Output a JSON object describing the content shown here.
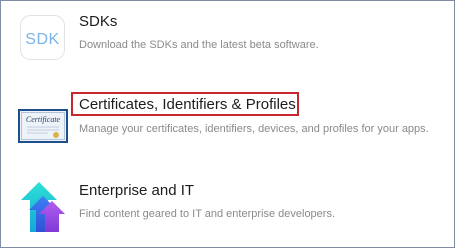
{
  "items": [
    {
      "title": "SDKs",
      "description": "Download the SDKs and the latest beta software.",
      "icon": "sdk-icon",
      "icon_text": "SDK"
    },
    {
      "title": "Certificates, Identifiers & Profiles",
      "description": "Manage your certificates, identifiers, devices, and profiles for your apps.",
      "icon": "certificate-icon",
      "icon_text": "Certificate",
      "highlighted": true
    },
    {
      "title": "Enterprise and IT",
      "description": "Find content geared to IT and enterprise developers.",
      "icon": "enterprise-arrows-icon"
    }
  ],
  "colors": {
    "highlight": "#c8272d",
    "title": "#1d1d1f",
    "description": "#8a8a8a",
    "frame_border": "#7f8da4",
    "sdk_icon_blue": "#7ab4ea"
  }
}
